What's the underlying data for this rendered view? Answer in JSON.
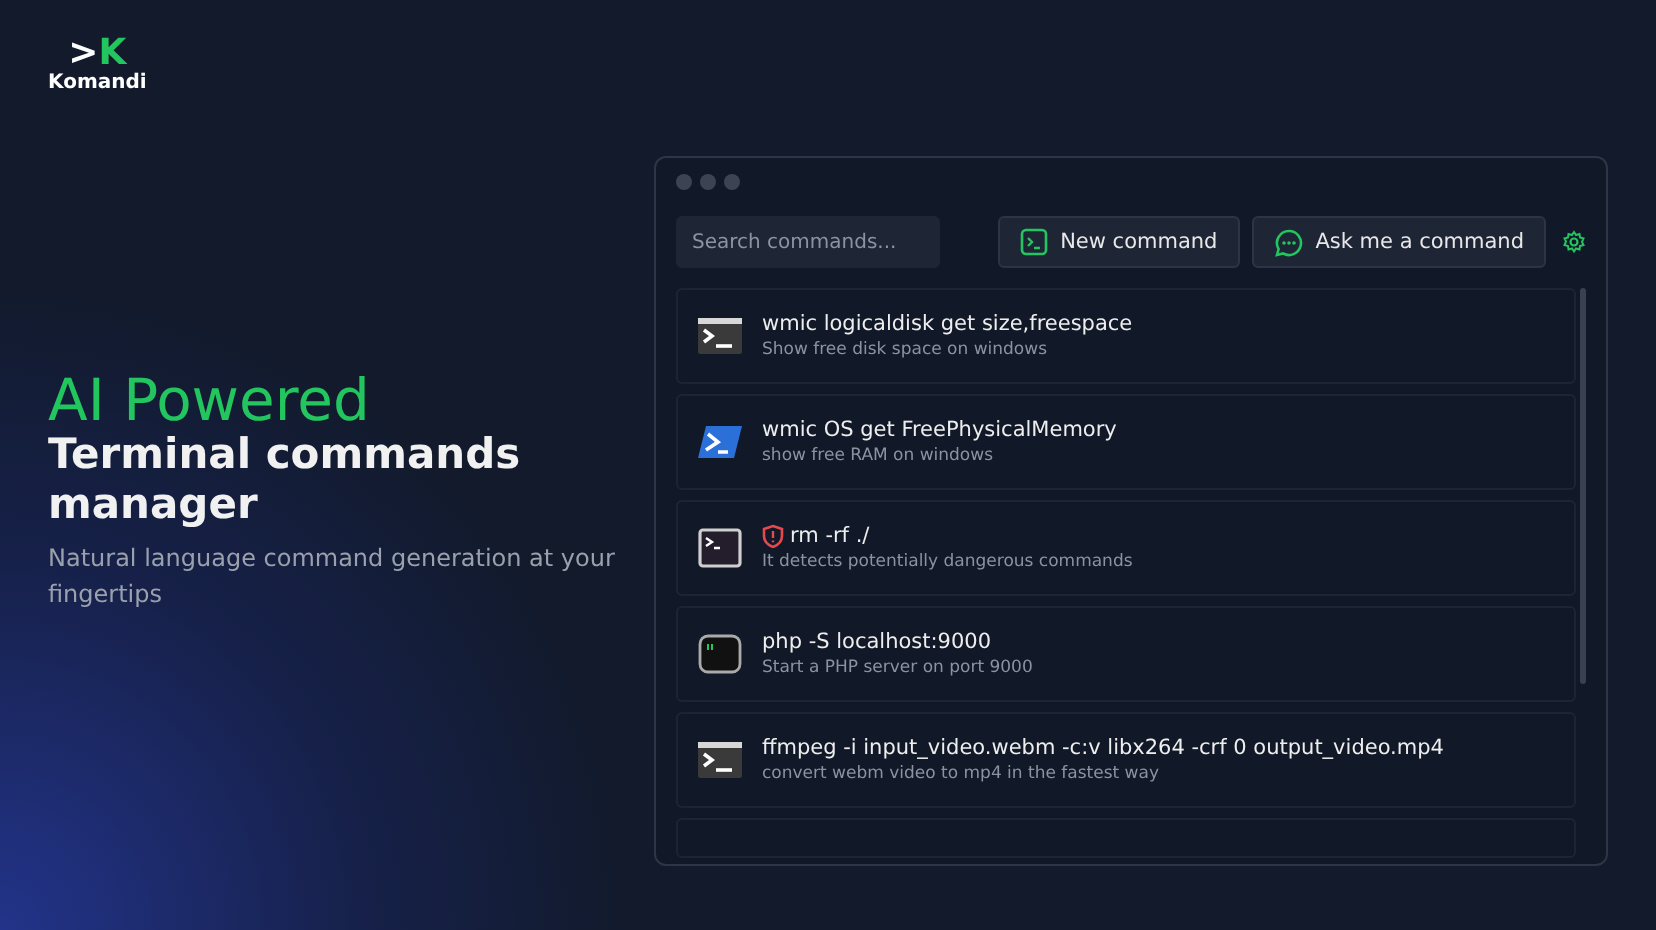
{
  "logo": {
    "mark_prompt": ">",
    "mark_letter": "K",
    "name": "Komandi"
  },
  "hero": {
    "highlight": "AI Powered",
    "title": "Terminal commands manager",
    "subtitle": "Natural language command generation at your fingertips"
  },
  "app_window": {
    "search": {
      "placeholder": "Search commands..."
    },
    "buttons": [
      {
        "label": "New command",
        "kind": "terminal"
      },
      {
        "label": "Ask me a command",
        "kind": "chat"
      }
    ],
    "commands": [
      {
        "command": "wmic logicaldisk get size,freespace",
        "description": "Show free disk space on windows",
        "kind": "cmd",
        "dangerous": false
      },
      {
        "command": "wmic OS get FreePhysicalMemory",
        "description": "show free RAM on windows",
        "kind": "powershell",
        "dangerous": false
      },
      {
        "command": "rm -rf ./",
        "description": "It detects potentially dangerous commands",
        "kind": "terminal",
        "dangerous": true
      },
      {
        "command": "php -S localhost:9000",
        "description": "Start a PHP server on port 9000",
        "kind": "console",
        "dangerous": false
      },
      {
        "command": "ffmpeg -i input_video.webm -c:v libx264 -crf 0 output_video.mp4",
        "description": "convert webm video to mp4 in the fastest way",
        "kind": "cmd",
        "dangerous": false
      }
    ]
  }
}
